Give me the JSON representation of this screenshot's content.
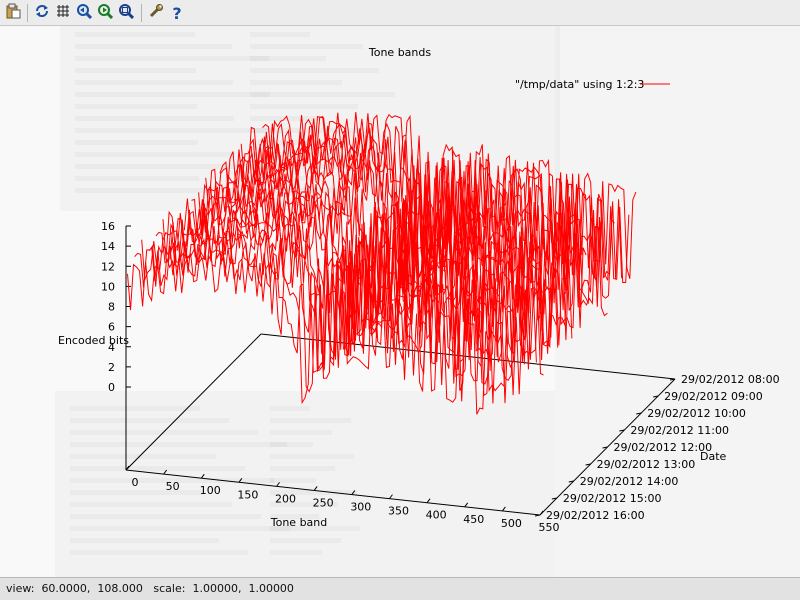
{
  "toolbar": {
    "buttons": [
      {
        "name": "copy-to-clipboard",
        "icon": "clipboard-icon"
      },
      {
        "name": "replot",
        "icon": "refresh-icon"
      },
      {
        "name": "toggle-grid",
        "icon": "grid-icon"
      },
      {
        "name": "previous-zoom",
        "icon": "zoom-previous-icon"
      },
      {
        "name": "next-zoom",
        "icon": "zoom-next-icon"
      },
      {
        "name": "autoscale",
        "icon": "zoom-autoscale-icon"
      },
      {
        "name": "configure",
        "icon": "wrench-icon"
      },
      {
        "name": "help",
        "icon": "help-icon"
      }
    ]
  },
  "status": {
    "view_label": "view:",
    "view_value": "60.0000,  108.000",
    "scale_label": "scale:",
    "scale_value": "1.00000,  1.00000"
  },
  "colors": {
    "series": "#ff0000",
    "axes": "#000000",
    "background": "#f9f9f9"
  },
  "chart_data": {
    "type": "line",
    "title": "Tone bands",
    "view": "3d-surface-lines",
    "view_angles": [
      60,
      108
    ],
    "xlabel": "Tone band",
    "ylabel": "Date",
    "zlabel": "Encoded bits",
    "xlim": [
      0,
      550
    ],
    "xticks": [
      "0",
      "50",
      "100",
      "150",
      "200",
      "250",
      "300",
      "350",
      "400",
      "450",
      "500",
      "550"
    ],
    "ylim": [
      "29/02/2012 08:00",
      "29/02/2012 16:00"
    ],
    "yticks": [
      "29/02/2012 08:00",
      "29/02/2012 09:00",
      "29/02/2012 10:00",
      "29/02/2012 11:00",
      "29/02/2012 12:00",
      "29/02/2012 13:00",
      "29/02/2012 14:00",
      "29/02/2012 15:00",
      "29/02/2012 16:00"
    ],
    "zlim": [
      0,
      16
    ],
    "zticks": [
      "0",
      "2",
      "4",
      "6",
      "8",
      "10",
      "12",
      "14",
      "16"
    ],
    "legend": {
      "label": "\"/tmp/data\" using 1:2:3",
      "position": "top-right"
    },
    "grid": false,
    "series": [
      {
        "name": "\"/tmp/data\" using 1:2:3",
        "tone_band": [
          0,
          50,
          100,
          150,
          200,
          230,
          250,
          300,
          350,
          400,
          450,
          500
        ],
        "encoded_bits_upper": [
          13,
          14,
          15,
          15,
          15,
          11,
          13,
          13,
          12.5,
          12,
          11,
          10
        ],
        "encoded_bits_lower": [
          8,
          10,
          11,
          11,
          9,
          0,
          3,
          5,
          5,
          3,
          2,
          1
        ]
      }
    ]
  }
}
